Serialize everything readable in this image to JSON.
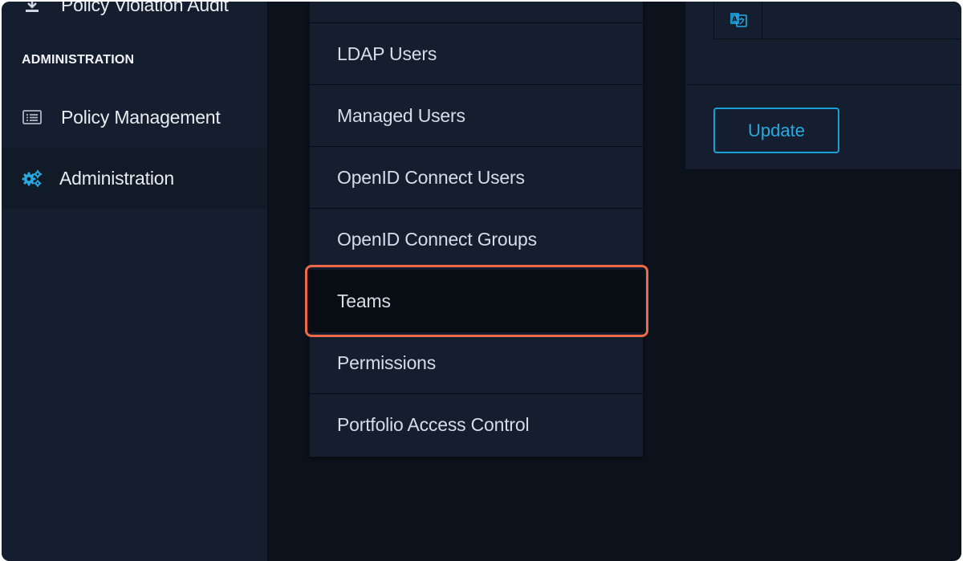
{
  "sidebar": {
    "partial_item": "Policy Violation Audit",
    "section_label": "ADMINISTRATION",
    "items": [
      {
        "label": "Policy Management",
        "icon": "list-icon"
      },
      {
        "label": "Administration",
        "icon": "gears-icon"
      }
    ]
  },
  "submenu": {
    "items": [
      {
        "label": "LDAP Users"
      },
      {
        "label": "Managed Users"
      },
      {
        "label": "OpenID Connect Users"
      },
      {
        "label": "OpenID Connect Groups"
      },
      {
        "label": "Teams"
      },
      {
        "label": "Permissions"
      },
      {
        "label": "Portfolio Access Control"
      }
    ]
  },
  "panel": {
    "field_icon": "translate-icon",
    "update_label": "Update"
  },
  "colors": {
    "accent": "#29a9e0",
    "highlight": "#ec6a47",
    "sidebar_bg": "#141e2e",
    "content_bg": "#0c121b"
  }
}
